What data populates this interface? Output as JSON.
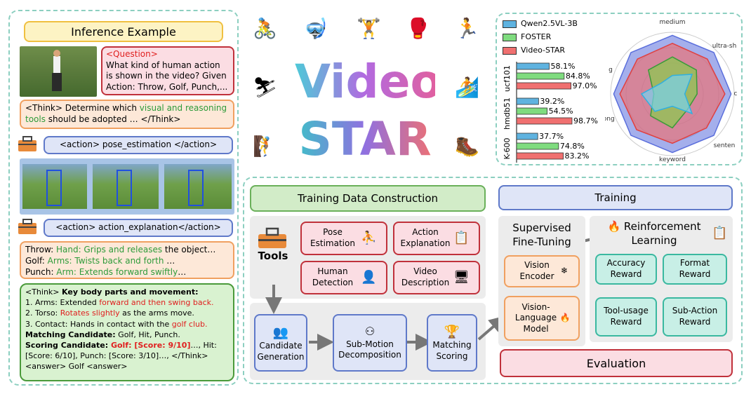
{
  "left": {
    "title": "Inference Example",
    "question_tag": "<Question>",
    "question_text": "What kind of human action is shown in the video? Given Action: Throw, Golf, Punch,...",
    "think1_a": "<Think> Determine which ",
    "think1_b": "visual and reasoning tools",
    "think1_c": " should be adopted … </Think>",
    "action1": "<action> pose_estimation </action>",
    "action2": "<action> action_explanation</action>",
    "expl": [
      {
        "name": "Throw: ",
        "part": "Hand: Grips and releases",
        "rest": " the object…"
      },
      {
        "name": "Golf: ",
        "part": "Arms: Twists back and forth",
        "rest": " …"
      },
      {
        "name": "Punch: ",
        "part": "Arm: Extends forward swiftly",
        "rest": "…"
      }
    ],
    "reason": {
      "head_a": "<Think> ",
      "head_b": "Key body parts and movement:",
      "l1a": "1. Arms: Extended ",
      "l1b": "forward and then swing back.",
      "l2a": "2. Torso: ",
      "l2b": "Rotates slightly",
      "l2c": " as the arms move.",
      "l3a": "3. Contact: Hands in contact with the ",
      "l3b": "golf club.",
      "m_label": "Matching Candidate:",
      "m_val": " Golf, Hit, Punch.",
      "s_label": "Scoring Candidate: ",
      "s_red": "Golf: [Score: 9/10]",
      "s_rest": "…, Hit: [Score: 6/10], Punch: [Score: 3/10]…, </Think>",
      "answer": "<answer> Golf <answer>"
    }
  },
  "logo": {
    "word1": "Video",
    "word2": "STAR"
  },
  "chart": {
    "legend": [
      "Qwen2.5VL-3B",
      "FOSTER",
      "Video-STAR"
    ],
    "radar_labels": [
      "medium",
      "ultra-sh",
      "g",
      "c",
      "long",
      "senten",
      "keyword"
    ]
  },
  "chart_data": {
    "type": "bar",
    "categories": [
      "ucf101",
      "hmdb51",
      "K-600"
    ],
    "series": [
      {
        "name": "Qwen2.5VL-3B",
        "values": [
          58.1,
          39.2,
          37.7
        ],
        "labels": [
          "58.1%",
          "39.2%",
          "37.7%"
        ],
        "color": "#5fb3e0"
      },
      {
        "name": "FOSTER",
        "values": [
          84.8,
          54.5,
          74.8
        ],
        "labels": [
          "84.8%",
          "54.5%",
          "74.8%"
        ],
        "color": "#7fdc7f"
      },
      {
        "name": "Video-STAR",
        "values": [
          97.0,
          98.7,
          83.2
        ],
        "labels": [
          "97.0%",
          "98.7%",
          "83.2%"
        ],
        "color": "#f07070"
      }
    ],
    "xlim": [
      0,
      100
    ]
  },
  "tdc": {
    "title": "Training Data Construction",
    "tools": "Tools",
    "tool_items": [
      "Pose Estimation",
      "Action Explanation",
      "Human Detection",
      "Video Description"
    ],
    "steps": [
      "Candidate Generation",
      "Sub-Motion Decomposition",
      "Matching Scoring"
    ]
  },
  "training": {
    "title": "Training",
    "sft": "Supervised Fine-Tuning",
    "rl": "Reinforcement Learning",
    "vision_encoder": "Vision Encoder",
    "vlm": "Vision-Language Model",
    "rewards": [
      "Accuracy Reward",
      "Format Reward",
      "Tool-usage Reward",
      "Sub-Action Reward"
    ]
  },
  "evaluation": "Evaluation"
}
